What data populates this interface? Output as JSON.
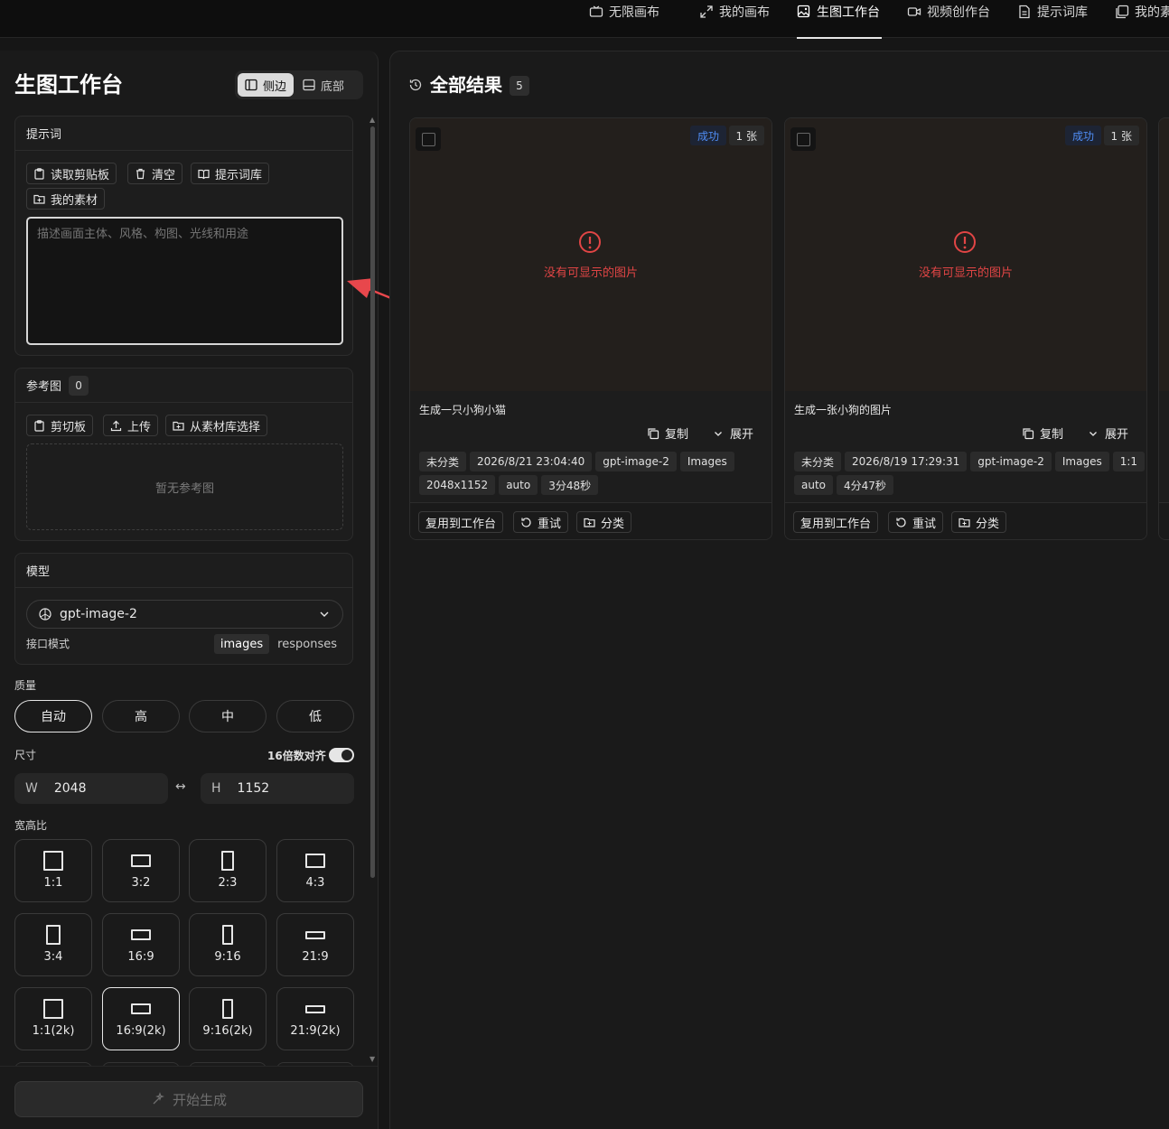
{
  "nav": {
    "items": [
      {
        "label": "无限画布",
        "icon": "canvas-icon"
      },
      {
        "label": "我的画布",
        "icon": "expand-icon"
      },
      {
        "label": "生图工作台",
        "icon": "image-edit-icon",
        "active": true
      },
      {
        "label": "视频创作台",
        "icon": "video-icon"
      },
      {
        "label": "提示词库",
        "icon": "document-icon"
      },
      {
        "label": "我的素",
        "icon": "gallery-icon"
      }
    ]
  },
  "left": {
    "title": "生图工作台",
    "layout": {
      "side": "侧边",
      "bottom": "底部",
      "active": "side"
    },
    "prompt": {
      "header": "提示词",
      "buttons": {
        "clipboard": "读取剪贴板",
        "clear": "清空",
        "library": "提示词库",
        "assets": "我的素材"
      },
      "placeholder": "描述画面主体、风格、构图、光线和用途",
      "value": ""
    },
    "reference": {
      "header": "参考图",
      "count": "0",
      "buttons": {
        "clipboard": "剪切板",
        "upload": "上传",
        "from_assets": "从素材库选择"
      },
      "empty": "暂无参考图"
    },
    "model": {
      "header": "模型",
      "selected": "gpt-image-2",
      "api_label": "接口模式",
      "api_options": [
        "images",
        "responses"
      ],
      "api_selected": "images"
    },
    "quality": {
      "label": "质量",
      "options": [
        "自动",
        "高",
        "中",
        "低"
      ],
      "selected": "自动"
    },
    "size": {
      "label": "尺寸",
      "align_label": "16倍数对齐",
      "align_on": true,
      "w_key": "W",
      "w": "2048",
      "h_key": "H",
      "h": "1152",
      "link": "↔"
    },
    "ratio": {
      "label": "宽高比",
      "options": [
        "1:1",
        "3:2",
        "2:3",
        "4:3",
        "3:4",
        "16:9",
        "9:16",
        "21:9",
        "1:1(2k)",
        "16:9(2k)",
        "9:16(2k)",
        "21:9(2k)"
      ],
      "selected": "16:9(2k)"
    },
    "generate": "开始生成"
  },
  "results": {
    "title": "全部结果",
    "count": "5",
    "cards": [
      {
        "status": "成功",
        "num": "1 张",
        "error": "没有可显示的图片",
        "prompt": "生成一只小狗小猫",
        "copy": "复制",
        "expand": "展开",
        "tags": [
          "未分类",
          "2026/8/21 23:04:40",
          "gpt-image-2",
          "Images",
          "2048x1152",
          "auto",
          "3分48秒"
        ],
        "reuse": "复用到工作台",
        "retry": "重试",
        "classify": "分类"
      },
      {
        "status": "成功",
        "num": "1 张",
        "error": "没有可显示的图片",
        "prompt": "生成一张小狗的图片",
        "copy": "复制",
        "expand": "展开",
        "tags": [
          "未分类",
          "2026/8/19 17:29:31",
          "gpt-image-2",
          "Images",
          "1:1",
          "auto",
          "4分47秒"
        ],
        "reuse": "复用到工作台",
        "retry": "重试",
        "classify": "分类"
      }
    ]
  },
  "colors": {
    "accent_error": "#e14545",
    "status_blue": "#4f8cf3",
    "annotation_arrow": "#e8474c"
  }
}
